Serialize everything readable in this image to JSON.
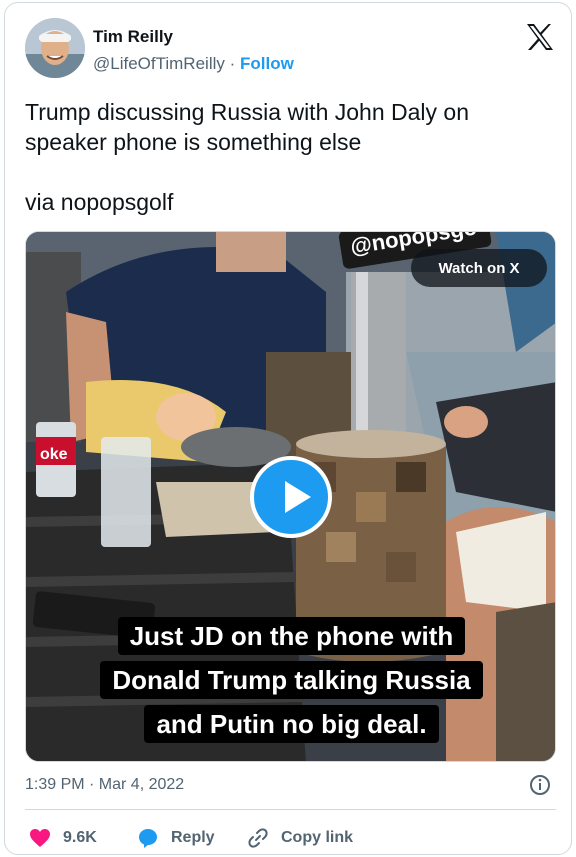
{
  "author": {
    "name": "Tim Reilly",
    "handle": "@LifeOfTimReilly",
    "separator": "·",
    "follow_label": "Follow"
  },
  "tweet": {
    "text": "Trump discussing Russia with John Daly on\nspeaker phone is something else\n\nvia nopopsgolf"
  },
  "media": {
    "watermark": "@nopopsgo",
    "watch_label": "Watch on X",
    "caption_lines": [
      "Just JD on the phone with",
      "Donald Trump talking Russia",
      "and Putin no big deal."
    ],
    "can_label": "oke"
  },
  "meta": {
    "timestamp": "1:39 PM · Mar 4, 2022"
  },
  "actions": {
    "like_count": "9.6K",
    "reply_label": "Reply",
    "copy_label": "Copy link"
  },
  "colors": {
    "accent": "#1d9bf0",
    "like": "#f91880",
    "muted": "#536471"
  },
  "icons": [
    "x-logo-icon",
    "play-icon",
    "info-icon",
    "heart-icon",
    "reply-bubble-icon",
    "link-icon"
  ]
}
